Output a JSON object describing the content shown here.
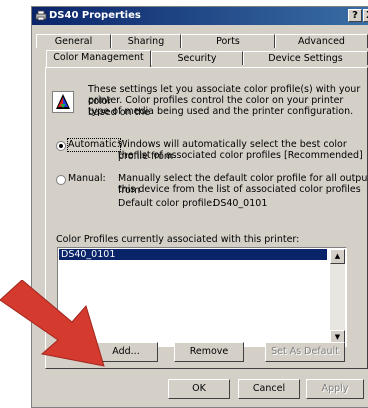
{
  "window": {
    "title": "DS40 Properties",
    "help_btn": "?",
    "close_btn": "X"
  },
  "tabs": {
    "row1": [
      "General",
      "Sharing",
      "Ports",
      "Advanced"
    ],
    "row2": [
      "Color Management",
      "Security",
      "Device Settings"
    ],
    "active": "Color Management"
  },
  "panel": {
    "intro": [
      "These settings let you associate color profile(s) with your color",
      "printer. Color profiles control the color on your printer based on the",
      "type of media being used and the printer configuration."
    ],
    "automatic": {
      "label": "Automatic:",
      "desc": [
        "Windows will automatically select the best color profile from",
        "the list of associated color profiles [Recommended]"
      ],
      "selected": true
    },
    "manual": {
      "label": "Manual:",
      "desc": [
        "Manually select the default color profile for all output from",
        "this device from the list of associated color profiles"
      ],
      "selected": false
    },
    "default_profile_label": "Default color profile:",
    "default_profile_value": "DS40_0101",
    "list_label": "Color Profiles currently associated with this printer:",
    "profiles": [
      "DS40_0101"
    ],
    "add_btn": "Add...",
    "remove_btn": "Remove",
    "set_default_btn": "Set As Default"
  },
  "footer": {
    "ok": "OK",
    "cancel": "Cancel",
    "apply": "Apply"
  },
  "colors": {
    "titlebar_start": "#0a246a",
    "titlebar_end": "#3a6ea5",
    "dialog_face": "#d4d0c8",
    "selection": "#0a246a",
    "arrow": "#d43a2e"
  }
}
